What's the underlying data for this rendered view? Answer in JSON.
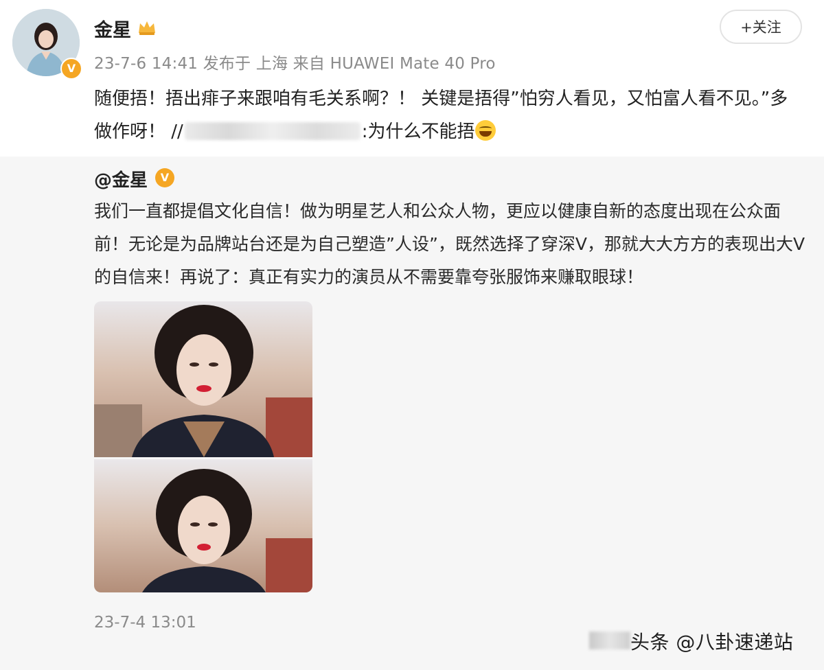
{
  "post": {
    "author_name": "金星",
    "meta": "23-7-6 14:41  发布于 上海  来自 HUAWEI Mate 40 Pro",
    "follow_label": "+关注",
    "text_part1": "随便捂！捂出痱子来跟咱有毛关系啊？！ 关键是捂得”怕穷人看见，又怕富人看不见。”多做作呀！ //",
    "text_part2": ":为什么不能捂",
    "emoji_icon": "laughing-emoji-icon"
  },
  "repost": {
    "author": "@金星",
    "verified_badge": "V",
    "text": "我们一直都提倡文化自信！做为明星艺人和公众人物，更应以健康自新的态度出现在公众面前！无论是为品牌站台还是为自己塑造”人设”，既然选择了穿深V，那就大大方方的表现出大V的自信来！再说了：真正有实力的演员从不需要靠夸张服饰来赚取眼球！",
    "time": "23-7-4 13:01"
  },
  "watermark": "头条 @八卦速递站",
  "colors": {
    "meta_gray": "#8a8a8a",
    "repost_bg": "#f6f6f6",
    "verified_orange": "#f5a623"
  }
}
